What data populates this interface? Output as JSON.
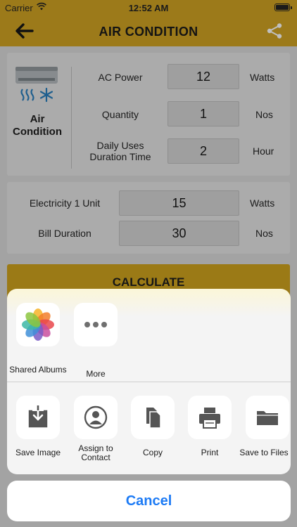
{
  "status_bar": {
    "carrier": "Carrier",
    "time": "12:52 AM"
  },
  "nav": {
    "title": "AIR CONDITION"
  },
  "device": {
    "name": "Air Condition",
    "fields": [
      {
        "label": "AC Power",
        "value": "12",
        "unit": "Watts"
      },
      {
        "label": "Quantity",
        "value": "1",
        "unit": "Nos"
      },
      {
        "label": "Daily Uses Duration Time",
        "value": "2",
        "unit": "Hour"
      }
    ]
  },
  "billing": {
    "fields": [
      {
        "label": "Electricity 1 Unit",
        "value": "15",
        "unit": "Watts"
      },
      {
        "label": "Bill Duration",
        "value": "30",
        "unit": "Nos"
      }
    ]
  },
  "calculate_label": "CALCULATE",
  "share_sheet": {
    "apps": [
      {
        "label": "Shared Albums",
        "icon": "photos-icon"
      },
      {
        "label": "More",
        "icon": "more-icon"
      }
    ],
    "actions": [
      {
        "label": "Save Image",
        "icon": "save-image-icon"
      },
      {
        "label": "Assign to Contact",
        "icon": "contact-icon"
      },
      {
        "label": "Copy",
        "icon": "copy-icon"
      },
      {
        "label": "Print",
        "icon": "print-icon"
      },
      {
        "label": "Save to Files",
        "icon": "folder-icon"
      }
    ],
    "cancel_label": "Cancel"
  },
  "colors": {
    "accent": "#f0b92a",
    "cancel_text": "#1d7bf5"
  }
}
